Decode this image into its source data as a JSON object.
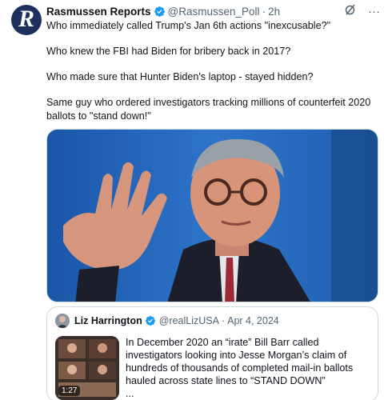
{
  "post": {
    "author_name": "Rasmussen Reports",
    "author_handle": "@Rasmussen_Poll",
    "separator": "·",
    "time": "2h",
    "paragraphs": [
      "Who immediately called Trump's Jan 6th actions \"inexcusable?\"",
      "Who knew the FBI had Biden for bribery back in 2017?",
      "Who made sure that Hunter Biden's laptop - stayed hidden?",
      "Same guy who ordered investigators tracking millions of counterfeit 2020 ballots to \"stand down!\""
    ],
    "more_glyph": "···",
    "grok_glyph": "∅"
  },
  "quote": {
    "author_name": "Liz Harrington",
    "author_handle": "@realLizUSA",
    "separator": "·",
    "date": "Apr 4, 2024",
    "text": "In December 2020 an “irate” Bill Barr called investigators looking into Jesse Morgan’s claim of hundreds of thousands of completed mail-in ballots hauled across state lines to “STAND DOWN”",
    "ellipsis": "...",
    "video_duration": "1:27"
  },
  "colors": {
    "verified": "#1d9bf0",
    "muted_text": "#536471",
    "avatar_bg": "#1d2f5c",
    "media_bg": "#2a6ec4"
  }
}
